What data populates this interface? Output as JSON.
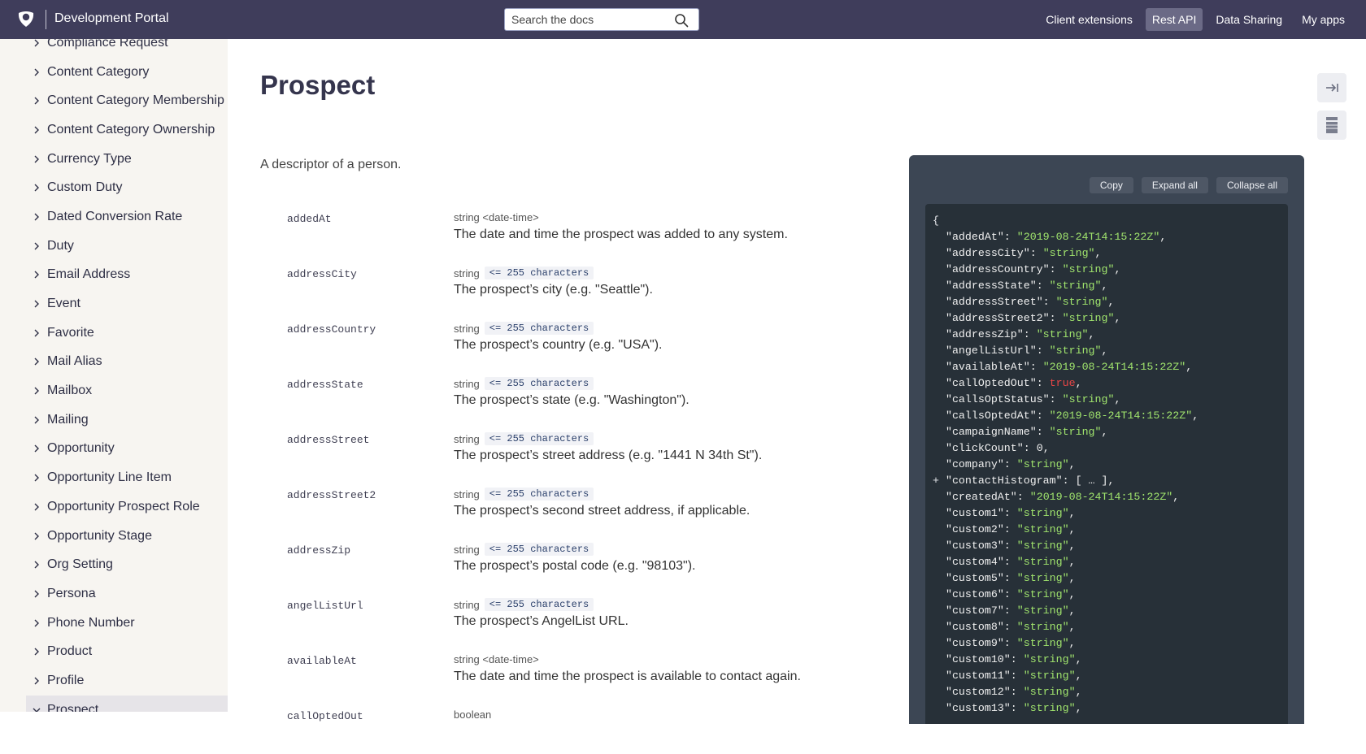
{
  "header": {
    "title": "Development Portal",
    "search_placeholder": "Search the docs",
    "nav": [
      "Client extensions",
      "Rest API",
      "Data Sharing",
      "My apps"
    ],
    "active_nav": "Rest API"
  },
  "sidebar": {
    "items": [
      "Compliance Request",
      "Content Category",
      "Content Category Membership",
      "Content Category Ownership",
      "Currency Type",
      "Custom Duty",
      "Dated Conversion Rate",
      "Duty",
      "Email Address",
      "Event",
      "Favorite",
      "Mail Alias",
      "Mailbox",
      "Mailing",
      "Opportunity",
      "Opportunity Line Item",
      "Opportunity Prospect Role",
      "Opportunity Stage",
      "Org Setting",
      "Persona",
      "Phone Number",
      "Product",
      "Profile",
      "Prospect"
    ],
    "active": "Prospect"
  },
  "main": {
    "title": "Prospect",
    "description": "A descriptor of a person.",
    "fields": [
      {
        "name": "addedAt",
        "type": "string <date-time>",
        "constraint": "",
        "description": "The date and time the prospect was added to any system."
      },
      {
        "name": "addressCity",
        "type": "string",
        "constraint": "<= 255 characters",
        "description": "The prospect’s city (e.g. \"Seattle\")."
      },
      {
        "name": "addressCountry",
        "type": "string",
        "constraint": "<= 255 characters",
        "description": "The prospect’s country (e.g. \"USA\")."
      },
      {
        "name": "addressState",
        "type": "string",
        "constraint": "<= 255 characters",
        "description": "The prospect’s state (e.g. \"Washington\")."
      },
      {
        "name": "addressStreet",
        "type": "string",
        "constraint": "<= 255 characters",
        "description": "The prospect’s street address (e.g. \"1441 N 34th St\")."
      },
      {
        "name": "addressStreet2",
        "type": "string",
        "constraint": "<= 255 characters",
        "description": "The prospect’s second street address, if applicable."
      },
      {
        "name": "addressZip",
        "type": "string",
        "constraint": "<= 255 characters",
        "description": "The prospect’s postal code (e.g. \"98103\")."
      },
      {
        "name": "angelListUrl",
        "type": "string",
        "constraint": "<= 255 characters",
        "description": "The prospect’s AngelList URL."
      },
      {
        "name": "availableAt",
        "type": "string <date-time>",
        "constraint": "",
        "description": "The date and time the prospect is available to contact again."
      },
      {
        "name": "callOptedOut",
        "type": "boolean",
        "constraint": "",
        "description": ""
      }
    ]
  },
  "code_panel": {
    "buttons": {
      "copy": "Copy",
      "expand": "Expand all",
      "collapse": "Collapse all"
    },
    "open_brace": "{",
    "entries": [
      {
        "key": "addedAt",
        "value": "\"2019-08-24T14:15:22Z\"",
        "kind": "s"
      },
      {
        "key": "addressCity",
        "value": "\"string\"",
        "kind": "s"
      },
      {
        "key": "addressCountry",
        "value": "\"string\"",
        "kind": "s"
      },
      {
        "key": "addressState",
        "value": "\"string\"",
        "kind": "s"
      },
      {
        "key": "addressStreet",
        "value": "\"string\"",
        "kind": "s"
      },
      {
        "key": "addressStreet2",
        "value": "\"string\"",
        "kind": "s"
      },
      {
        "key": "addressZip",
        "value": "\"string\"",
        "kind": "s"
      },
      {
        "key": "angelListUrl",
        "value": "\"string\"",
        "kind": "s"
      },
      {
        "key": "availableAt",
        "value": "\"2019-08-24T14:15:22Z\"",
        "kind": "s"
      },
      {
        "key": "callOptedOut",
        "value": "true",
        "kind": "b"
      },
      {
        "key": "callsOptStatus",
        "value": "\"string\"",
        "kind": "s"
      },
      {
        "key": "callsOptedAt",
        "value": "\"2019-08-24T14:15:22Z\"",
        "kind": "s"
      },
      {
        "key": "campaignName",
        "value": "\"string\"",
        "kind": "s"
      },
      {
        "key": "clickCount",
        "value": "0",
        "kind": "n"
      },
      {
        "key": "company",
        "value": "\"string\"",
        "kind": "s"
      },
      {
        "key": "contactHistogram",
        "value": "[ … ]",
        "kind": "n",
        "collapsed": true
      },
      {
        "key": "createdAt",
        "value": "\"2019-08-24T14:15:22Z\"",
        "kind": "s"
      },
      {
        "key": "custom1",
        "value": "\"string\"",
        "kind": "s"
      },
      {
        "key": "custom2",
        "value": "\"string\"",
        "kind": "s"
      },
      {
        "key": "custom3",
        "value": "\"string\"",
        "kind": "s"
      },
      {
        "key": "custom4",
        "value": "\"string\"",
        "kind": "s"
      },
      {
        "key": "custom5",
        "value": "\"string\"",
        "kind": "s"
      },
      {
        "key": "custom6",
        "value": "\"string\"",
        "kind": "s"
      },
      {
        "key": "custom7",
        "value": "\"string\"",
        "kind": "s"
      },
      {
        "key": "custom8",
        "value": "\"string\"",
        "kind": "s"
      },
      {
        "key": "custom9",
        "value": "\"string\"",
        "kind": "s"
      },
      {
        "key": "custom10",
        "value": "\"string\"",
        "kind": "s"
      },
      {
        "key": "custom11",
        "value": "\"string\"",
        "kind": "s"
      },
      {
        "key": "custom12",
        "value": "\"string\"",
        "kind": "s"
      },
      {
        "key": "custom13",
        "value": "\"string\"",
        "kind": "s"
      }
    ]
  },
  "colors": {
    "header_bg": "#3f3d5b",
    "sidebar_bg": "#f7f5f1",
    "code_bg": "#273038",
    "json_string": "#a0e46d",
    "json_bool": "#e84646"
  }
}
